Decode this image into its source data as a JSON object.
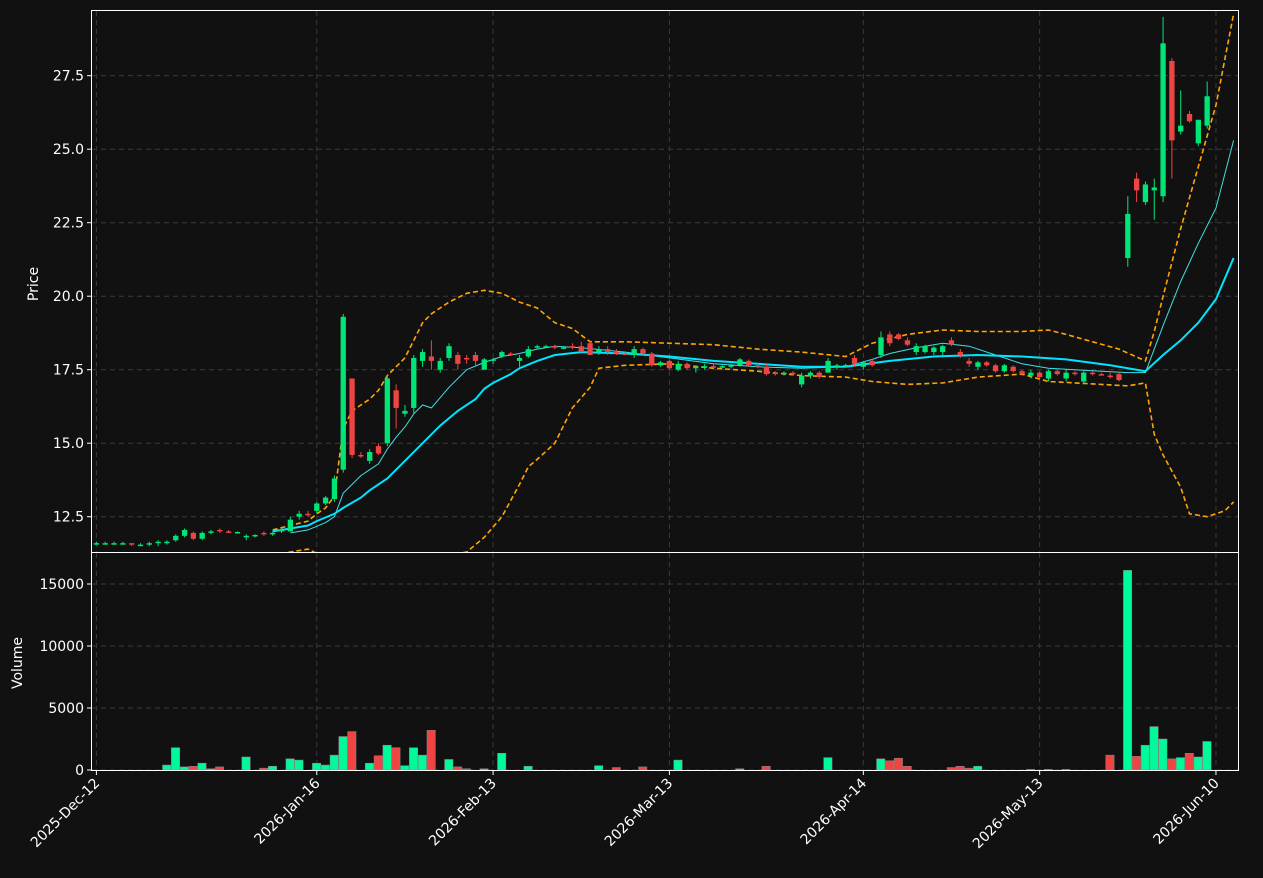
{
  "colors": {
    "background": "#111111",
    "up": "#00e676",
    "down": "#ef4444",
    "volume_up": "#00fa9a",
    "ma_fast": "#40e0e0",
    "ma_slow": "#00e5ff",
    "bollinger": "#ffa500",
    "grid": "#3a3a3a",
    "axis": "#ffffff"
  },
  "chart_data": {
    "type": "candlestick",
    "ylabel": "Price",
    "volume_ylabel": "Volume",
    "price_ylim": [
      11.3,
      29.7
    ],
    "volume_ylim": [
      0,
      17500
    ],
    "price_ticks": [
      "12.5",
      "15.0",
      "17.5",
      "20.0",
      "22.5",
      "25.0",
      "27.5"
    ],
    "volume_ticks": [
      "0",
      "5000",
      "10000",
      "15000"
    ],
    "x_ticks": [
      "2025-Dec-12",
      "2026-Jan-16",
      "2026-Feb-13",
      "2026-Mar-13",
      "2026-Apr-14",
      "2026-May-13",
      "2026-Jun-10"
    ],
    "x_tick_index": [
      0,
      25,
      45,
      65,
      87,
      107,
      127
    ],
    "x_range": [
      -0.5,
      129.5
    ],
    "grid": true,
    "candles": [
      [
        11.6,
        11.65,
        11.55,
        11.6,
        0
      ],
      [
        11.6,
        11.65,
        11.55,
        11.6,
        0
      ],
      [
        11.6,
        11.65,
        11.55,
        11.6,
        0
      ],
      [
        11.6,
        11.65,
        11.55,
        11.6,
        0
      ],
      [
        11.6,
        11.6,
        11.5,
        11.55,
        0
      ],
      [
        11.55,
        11.6,
        11.5,
        11.55,
        0
      ],
      [
        11.55,
        11.65,
        11.5,
        11.6,
        0
      ],
      [
        11.6,
        11.7,
        11.5,
        11.65,
        0
      ],
      [
        11.6,
        11.7,
        11.55,
        11.65,
        400
      ],
      [
        11.7,
        11.9,
        11.65,
        11.85,
        1800
      ],
      [
        11.85,
        12.1,
        11.8,
        12.05,
        250
      ],
      [
        11.95,
        12.0,
        11.7,
        11.75,
        300
      ],
      [
        11.75,
        12.0,
        11.7,
        11.95,
        550
      ],
      [
        11.95,
        12.05,
        11.9,
        12.0,
        100
      ],
      [
        12.05,
        12.1,
        11.95,
        12.0,
        250
      ],
      [
        12.0,
        12.05,
        11.95,
        11.98,
        0
      ],
      [
        11.98,
        12.0,
        11.95,
        11.98,
        0
      ],
      [
        11.8,
        11.9,
        11.7,
        11.85,
        1050
      ],
      [
        11.85,
        11.9,
        11.8,
        11.88,
        0
      ],
      [
        11.95,
        12.0,
        11.85,
        11.9,
        150
      ],
      [
        11.9,
        12.0,
        11.85,
        11.95,
        300
      ],
      [
        12.0,
        12.1,
        11.95,
        12.05,
        0
      ],
      [
        12.0,
        12.5,
        12.0,
        12.4,
        900
      ],
      [
        12.5,
        12.7,
        12.4,
        12.6,
        800
      ],
      [
        12.6,
        12.7,
        12.5,
        12.55,
        0
      ],
      [
        12.7,
        13.0,
        12.6,
        12.95,
        550
      ],
      [
        12.95,
        13.2,
        12.9,
        13.15,
        400
      ],
      [
        13.1,
        13.9,
        13.0,
        13.8,
        1200
      ],
      [
        14.1,
        19.4,
        14.0,
        19.3,
        2700
      ],
      [
        17.2,
        17.2,
        14.5,
        14.6,
        3100
      ],
      [
        14.6,
        14.7,
        14.5,
        14.55,
        0
      ],
      [
        14.4,
        14.8,
        14.3,
        14.7,
        550
      ],
      [
        14.9,
        15.0,
        14.6,
        14.65,
        1150
      ],
      [
        15.0,
        17.3,
        14.9,
        17.2,
        2000
      ],
      [
        16.8,
        17.0,
        15.5,
        16.2,
        1800
      ],
      [
        16.0,
        16.3,
        15.9,
        16.1,
        350
      ],
      [
        16.2,
        18.0,
        16.0,
        17.9,
        1800
      ],
      [
        17.8,
        18.2,
        17.6,
        18.1,
        1200
      ],
      [
        17.95,
        18.5,
        17.5,
        17.8,
        3200
      ],
      [
        17.5,
        17.9,
        17.4,
        17.8,
        0
      ],
      [
        17.9,
        18.4,
        17.8,
        18.3,
        850
      ],
      [
        18.0,
        18.1,
        17.5,
        17.7,
        250
      ],
      [
        17.9,
        18.0,
        17.7,
        17.85,
        100
      ],
      [
        18.0,
        18.1,
        17.6,
        17.8,
        0
      ],
      [
        17.5,
        17.9,
        17.5,
        17.85,
        100
      ],
      [
        17.8,
        17.9,
        17.7,
        17.85,
        0
      ],
      [
        17.95,
        18.15,
        17.9,
        18.1,
        1350
      ],
      [
        18.05,
        18.1,
        18.0,
        18.02,
        0
      ],
      [
        17.8,
        18.0,
        17.6,
        17.9,
        0
      ],
      [
        17.95,
        18.3,
        17.9,
        18.2,
        300
      ],
      [
        18.25,
        18.35,
        18.2,
        18.3,
        0
      ],
      [
        18.3,
        18.35,
        18.25,
        18.3,
        0
      ],
      [
        18.3,
        18.35,
        18.2,
        18.28,
        0
      ],
      [
        18.25,
        18.3,
        18.2,
        18.26,
        0
      ],
      [
        18.3,
        18.4,
        18.2,
        18.25,
        0
      ],
      [
        18.3,
        18.45,
        18.2,
        18.1,
        0
      ],
      [
        18.4,
        18.5,
        18.2,
        18.0,
        0
      ],
      [
        18.1,
        18.3,
        18.0,
        18.2,
        350
      ],
      [
        18.2,
        18.3,
        18.0,
        18.1,
        0
      ],
      [
        18.1,
        18.2,
        18.0,
        18.05,
        200
      ],
      [
        18.05,
        18.1,
        18.0,
        18.02,
        0
      ],
      [
        18.0,
        18.3,
        17.9,
        18.2,
        0
      ],
      [
        18.2,
        18.25,
        18.0,
        18.05,
        250
      ],
      [
        18.05,
        18.1,
        17.6,
        17.65,
        0
      ],
      [
        17.65,
        17.8,
        17.6,
        17.75,
        0
      ],
      [
        17.8,
        17.85,
        17.5,
        17.55,
        0
      ],
      [
        17.5,
        17.8,
        17.45,
        17.7,
        800
      ],
      [
        17.7,
        17.75,
        17.5,
        17.55,
        0
      ],
      [
        17.55,
        17.65,
        17.4,
        17.6,
        0
      ],
      [
        17.6,
        17.7,
        17.5,
        17.62,
        0
      ],
      [
        17.62,
        17.7,
        17.55,
        17.6,
        0
      ],
      [
        17.6,
        17.65,
        17.55,
        17.62,
        0
      ],
      [
        17.62,
        17.7,
        17.55,
        17.65,
        0
      ],
      [
        17.65,
        17.9,
        17.6,
        17.85,
        100
      ],
      [
        17.8,
        17.85,
        17.6,
        17.65,
        0
      ],
      [
        17.65,
        17.7,
        17.55,
        17.6,
        0
      ],
      [
        17.6,
        17.7,
        17.3,
        17.35,
        300
      ],
      [
        17.4,
        17.45,
        17.3,
        17.38,
        0
      ],
      [
        17.38,
        17.45,
        17.3,
        17.4,
        0
      ],
      [
        17.4,
        17.45,
        17.3,
        17.35,
        0
      ],
      [
        17.0,
        17.4,
        16.9,
        17.3,
        0
      ],
      [
        17.3,
        17.45,
        17.2,
        17.4,
        0
      ],
      [
        17.4,
        17.45,
        17.2,
        17.25,
        0
      ],
      [
        17.4,
        17.9,
        17.4,
        17.8,
        1000
      ],
      [
        17.6,
        17.7,
        17.5,
        17.65,
        0
      ],
      [
        17.65,
        17.7,
        17.6,
        17.66,
        0
      ],
      [
        17.9,
        18.0,
        17.6,
        17.7,
        0
      ],
      [
        17.6,
        17.8,
        17.5,
        17.75,
        0
      ],
      [
        17.8,
        17.85,
        17.6,
        17.65,
        0
      ],
      [
        18.0,
        18.8,
        17.9,
        18.6,
        900
      ],
      [
        18.7,
        18.8,
        18.3,
        18.4,
        750
      ],
      [
        18.7,
        18.75,
        18.5,
        18.55,
        950
      ],
      [
        18.5,
        18.6,
        18.3,
        18.35,
        300
      ],
      [
        18.1,
        18.4,
        18.0,
        18.3,
        0
      ],
      [
        18.1,
        18.35,
        18.05,
        18.3,
        0
      ],
      [
        18.1,
        18.3,
        18.0,
        18.25,
        0
      ],
      [
        18.1,
        18.35,
        18.0,
        18.3,
        0
      ],
      [
        18.5,
        18.6,
        18.3,
        18.35,
        200
      ],
      [
        18.1,
        18.2,
        17.9,
        18.0,
        300
      ],
      [
        17.8,
        17.9,
        17.6,
        17.7,
        150
      ],
      [
        17.6,
        17.8,
        17.5,
        17.75,
        300
      ],
      [
        17.75,
        17.8,
        17.6,
        17.65,
        0
      ],
      [
        17.65,
        17.7,
        17.4,
        17.45,
        0
      ],
      [
        17.45,
        17.7,
        17.4,
        17.65,
        0
      ],
      [
        17.6,
        17.65,
        17.4,
        17.45,
        0
      ],
      [
        17.45,
        17.5,
        17.3,
        17.35,
        0
      ],
      [
        17.3,
        17.5,
        17.2,
        17.4,
        50
      ],
      [
        17.4,
        17.45,
        17.2,
        17.25,
        0
      ],
      [
        17.2,
        17.5,
        17.1,
        17.45,
        50
      ],
      [
        17.45,
        17.5,
        17.3,
        17.35,
        0
      ],
      [
        17.2,
        17.5,
        17.1,
        17.4,
        50
      ],
      [
        17.4,
        17.45,
        17.3,
        17.35,
        0
      ],
      [
        17.1,
        17.45,
        17.0,
        17.4,
        0
      ],
      [
        17.4,
        17.45,
        17.3,
        17.35,
        0
      ],
      [
        17.35,
        17.4,
        17.3,
        17.32,
        0
      ],
      [
        17.3,
        17.4,
        17.2,
        17.25,
        1200
      ],
      [
        17.35,
        17.4,
        17.1,
        17.15,
        0
      ],
      [
        21.3,
        23.4,
        21.0,
        22.8,
        16100
      ],
      [
        24.0,
        24.2,
        23.2,
        23.6,
        1100
      ],
      [
        23.2,
        23.9,
        23.1,
        23.8,
        2000
      ],
      [
        23.6,
        24.0,
        22.6,
        23.7,
        3500
      ],
      [
        23.4,
        29.5,
        23.2,
        28.6,
        2500
      ],
      [
        28.0,
        28.1,
        24.0,
        25.3,
        900
      ],
      [
        25.6,
        27.0,
        25.5,
        25.8,
        1000
      ],
      [
        26.2,
        26.3,
        25.9,
        25.95,
        1350
      ],
      [
        25.2,
        26.0,
        25.1,
        26.0,
        1050
      ],
      [
        25.8,
        27.3,
        25.7,
        26.8,
        2300
      ]
    ],
    "ma_fast": [
      [
        22,
        11.95
      ],
      [
        24,
        12.05
      ],
      [
        26,
        12.3
      ],
      [
        27,
        12.5
      ],
      [
        28,
        13.3
      ],
      [
        30,
        13.9
      ],
      [
        31,
        14.1
      ],
      [
        32,
        14.3
      ],
      [
        33,
        14.8
      ],
      [
        34,
        15.2
      ],
      [
        35,
        15.55
      ],
      [
        36,
        16.0
      ],
      [
        37,
        16.3
      ],
      [
        38,
        16.2
      ],
      [
        40,
        16.9
      ],
      [
        42,
        17.5
      ],
      [
        44,
        17.75
      ],
      [
        46,
        17.95
      ],
      [
        48,
        18.05
      ],
      [
        50,
        18.2
      ],
      [
        52,
        18.3
      ],
      [
        55,
        18.25
      ],
      [
        60,
        18.1
      ],
      [
        65,
        17.9
      ],
      [
        70,
        17.7
      ],
      [
        75,
        17.6
      ],
      [
        80,
        17.55
      ],
      [
        85,
        17.6
      ],
      [
        88,
        17.85
      ],
      [
        90,
        18.05
      ],
      [
        93,
        18.25
      ],
      [
        96,
        18.4
      ],
      [
        99,
        18.3
      ],
      [
        102,
        18.0
      ],
      [
        105,
        17.7
      ],
      [
        108,
        17.55
      ],
      [
        111,
        17.5
      ],
      [
        114,
        17.45
      ],
      [
        117,
        17.4
      ],
      [
        119,
        17.4
      ],
      [
        121,
        19.0
      ],
      [
        123,
        20.5
      ],
      [
        125,
        21.8
      ],
      [
        127,
        23.0
      ],
      [
        129,
        25.3
      ]
    ],
    "ma_slow": [
      [
        20,
        12.0
      ],
      [
        22,
        12.1
      ],
      [
        24,
        12.2
      ],
      [
        25,
        12.35
      ],
      [
        27,
        12.6
      ],
      [
        28,
        12.8
      ],
      [
        30,
        13.15
      ],
      [
        31,
        13.4
      ],
      [
        33,
        13.8
      ],
      [
        35,
        14.4
      ],
      [
        37,
        15.0
      ],
      [
        39,
        15.6
      ],
      [
        41,
        16.1
      ],
      [
        43,
        16.5
      ],
      [
        44,
        16.85
      ],
      [
        45,
        17.05
      ],
      [
        46,
        17.2
      ],
      [
        47,
        17.35
      ],
      [
        48,
        17.55
      ],
      [
        50,
        17.8
      ],
      [
        52,
        18.0
      ],
      [
        55,
        18.1
      ],
      [
        60,
        18.05
      ],
      [
        65,
        17.95
      ],
      [
        70,
        17.8
      ],
      [
        75,
        17.7
      ],
      [
        80,
        17.6
      ],
      [
        85,
        17.6
      ],
      [
        90,
        17.8
      ],
      [
        95,
        17.95
      ],
      [
        100,
        18.0
      ],
      [
        105,
        17.95
      ],
      [
        110,
        17.85
      ],
      [
        115,
        17.65
      ],
      [
        119,
        17.45
      ],
      [
        121,
        18.0
      ],
      [
        123,
        18.5
      ],
      [
        125,
        19.1
      ],
      [
        127,
        19.9
      ],
      [
        129,
        21.3
      ]
    ],
    "bb_upper": [
      [
        20,
        12.05
      ],
      [
        22,
        12.2
      ],
      [
        24,
        12.35
      ],
      [
        25,
        12.6
      ],
      [
        26,
        12.8
      ],
      [
        27,
        13.2
      ],
      [
        28,
        15.5
      ],
      [
        29,
        16.1
      ],
      [
        30,
        16.3
      ],
      [
        31,
        16.5
      ],
      [
        32,
        16.8
      ],
      [
        33,
        17.3
      ],
      [
        34,
        17.6
      ],
      [
        35,
        17.9
      ],
      [
        36,
        18.5
      ],
      [
        37,
        19.1
      ],
      [
        38,
        19.4
      ],
      [
        40,
        19.8
      ],
      [
        42,
        20.1
      ],
      [
        44,
        20.2
      ],
      [
        46,
        20.1
      ],
      [
        48,
        19.8
      ],
      [
        50,
        19.6
      ],
      [
        52,
        19.1
      ],
      [
        54,
        18.9
      ],
      [
        56,
        18.45
      ],
      [
        60,
        18.45
      ],
      [
        65,
        18.4
      ],
      [
        70,
        18.35
      ],
      [
        75,
        18.2
      ],
      [
        80,
        18.1
      ],
      [
        85,
        17.95
      ],
      [
        88,
        18.4
      ],
      [
        92,
        18.7
      ],
      [
        96,
        18.85
      ],
      [
        100,
        18.8
      ],
      [
        105,
        18.8
      ],
      [
        108,
        18.85
      ],
      [
        110,
        18.7
      ],
      [
        113,
        18.45
      ],
      [
        116,
        18.2
      ],
      [
        119,
        17.8
      ],
      [
        120,
        18.8
      ],
      [
        121,
        20.0
      ],
      [
        123,
        22.3
      ],
      [
        125,
        24.4
      ],
      [
        127,
        26.5
      ],
      [
        129,
        29.6
      ]
    ],
    "bb_lower": [
      [
        20,
        11.2
      ],
      [
        22,
        11.3
      ],
      [
        24,
        11.4
      ],
      [
        26,
        11.1
      ],
      [
        28,
        10.5
      ],
      [
        30,
        10.2
      ],
      [
        32,
        10.3
      ],
      [
        34,
        10.6
      ],
      [
        36,
        10.9
      ],
      [
        38,
        11.1
      ],
      [
        40,
        11.2
      ],
      [
        42,
        11.3
      ],
      [
        44,
        11.8
      ],
      [
        46,
        12.5
      ],
      [
        48,
        13.6
      ],
      [
        49,
        14.2
      ],
      [
        50,
        14.45
      ],
      [
        52,
        15.0
      ],
      [
        53,
        15.6
      ],
      [
        54,
        16.2
      ],
      [
        56,
        16.9
      ],
      [
        57,
        17.55
      ],
      [
        60,
        17.65
      ],
      [
        65,
        17.7
      ],
      [
        70,
        17.55
      ],
      [
        75,
        17.45
      ],
      [
        80,
        17.3
      ],
      [
        85,
        17.25
      ],
      [
        88,
        17.1
      ],
      [
        92,
        17.0
      ],
      [
        96,
        17.05
      ],
      [
        98,
        17.15
      ],
      [
        100,
        17.25
      ],
      [
        105,
        17.35
      ],
      [
        108,
        17.1
      ],
      [
        111,
        17.05
      ],
      [
        114,
        17.0
      ],
      [
        117,
        16.95
      ],
      [
        119,
        17.05
      ],
      [
        120,
        15.3
      ],
      [
        121,
        14.6
      ],
      [
        123,
        13.5
      ],
      [
        124,
        12.6
      ],
      [
        126,
        12.5
      ],
      [
        128,
        12.7
      ],
      [
        129,
        13.0
      ]
    ]
  }
}
